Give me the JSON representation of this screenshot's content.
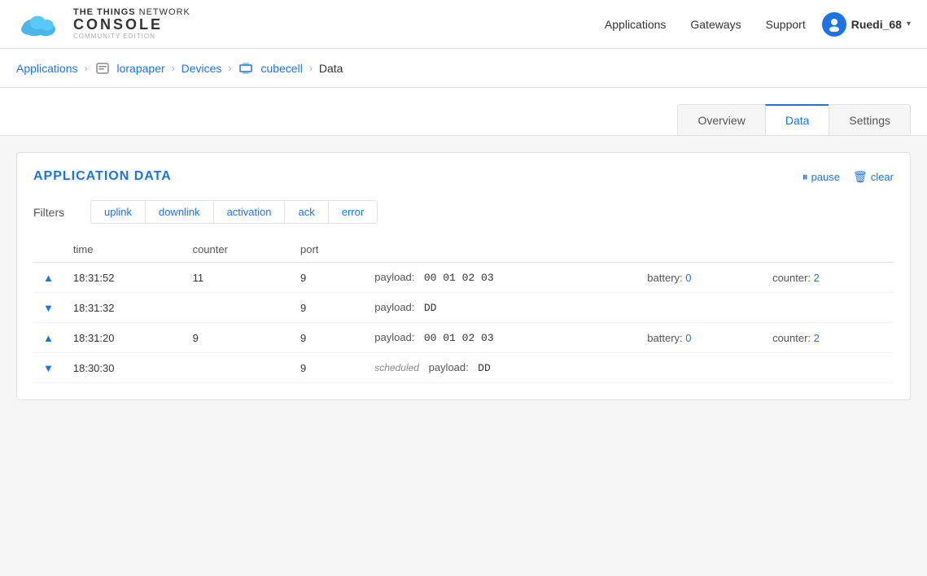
{
  "header": {
    "logo_ttn": "THE THINGS",
    "logo_network": "NETWORK",
    "logo_console": "CONSOLE",
    "logo_edition": "COMMUNITY EDITION",
    "nav": {
      "applications": "Applications",
      "gateways": "Gateways",
      "support": "Support"
    },
    "user": {
      "name": "Ruedi_68"
    }
  },
  "breadcrumb": {
    "applications": "Applications",
    "lorapaper": "lorapaper",
    "devices": "Devices",
    "cubecell": "cubecell",
    "data": "Data"
  },
  "tabs": {
    "overview": "Overview",
    "data": "Data",
    "settings": "Settings",
    "active": "Data"
  },
  "panel": {
    "title": "APPLICATION DATA",
    "pause": "pause",
    "clear": "clear"
  },
  "filters": {
    "label": "Filters",
    "pills": [
      "uplink",
      "downlink",
      "activation",
      "ack",
      "error"
    ]
  },
  "table": {
    "columns": [
      "time",
      "counter",
      "port"
    ],
    "rows": [
      {
        "direction": "up",
        "time": "18:31:52",
        "counter": "11",
        "port": "9",
        "payload_label": "payload:",
        "payload_value": "00 01 02 03",
        "meta": [
          {
            "label": "battery:",
            "value": "0"
          },
          {
            "label": "counter:",
            "value": "2"
          }
        ],
        "scheduled": false
      },
      {
        "direction": "down",
        "time": "18:31:32",
        "counter": "",
        "port": "9",
        "payload_label": "payload:",
        "payload_value": "DD",
        "meta": [],
        "scheduled": false
      },
      {
        "direction": "up",
        "time": "18:31:20",
        "counter": "9",
        "port": "9",
        "payload_label": "payload:",
        "payload_value": "00 01 02 03",
        "meta": [
          {
            "label": "battery:",
            "value": "0"
          },
          {
            "label": "counter:",
            "value": "2"
          }
        ],
        "scheduled": false
      },
      {
        "direction": "down",
        "time": "18:30:30",
        "counter": "",
        "port": "9",
        "payload_label": "payload:",
        "payload_value": "DD",
        "meta": [],
        "scheduled": true,
        "scheduled_label": "scheduled"
      }
    ]
  }
}
